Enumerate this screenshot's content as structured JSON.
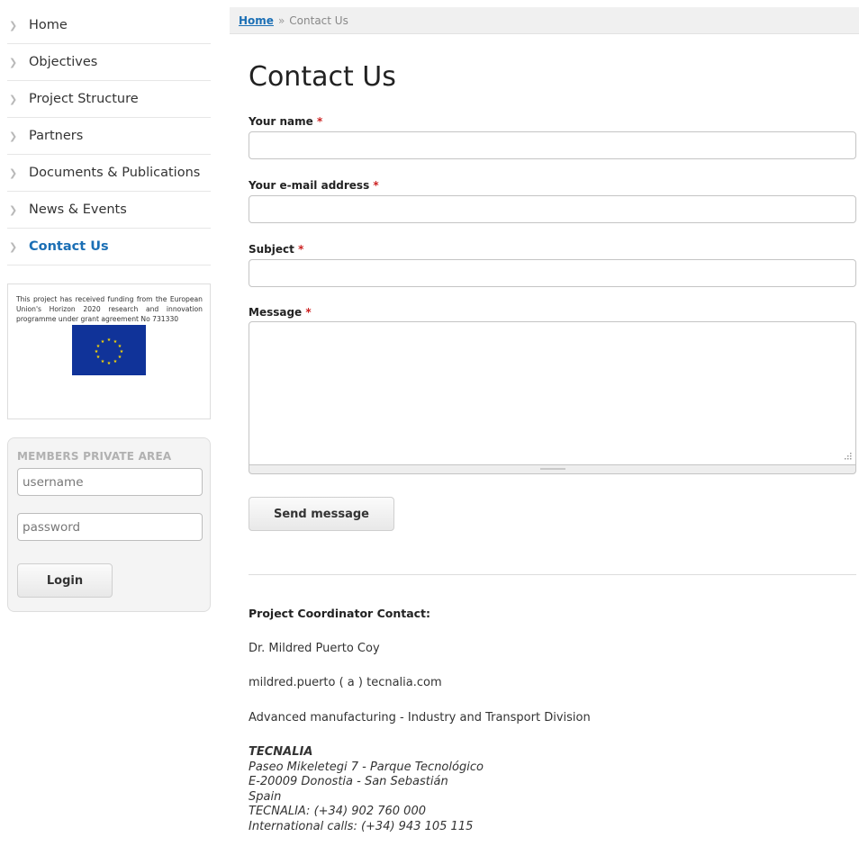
{
  "sidebar": {
    "nav": [
      {
        "label": "Home"
      },
      {
        "label": "Objectives"
      },
      {
        "label": "Project Structure"
      },
      {
        "label": "Partners"
      },
      {
        "label": "Documents & Publications"
      },
      {
        "label": "News & Events"
      },
      {
        "label": "Contact Us",
        "active": true
      }
    ],
    "funding_text": "This project has received funding from the European Union's Horizon 2020 research and innovation programme under grant agreement No 731330",
    "members": {
      "title": "MEMBERS PRIVATE AREA",
      "username_placeholder": "username",
      "password_placeholder": "password",
      "login_label": "Login"
    }
  },
  "breadcrumb": {
    "home": "Home",
    "separator": "»",
    "current": "Contact Us"
  },
  "form": {
    "title": "Contact Us",
    "name_label": "Your name",
    "email_label": "Your e-mail address",
    "subject_label": "Subject",
    "message_label": "Message",
    "required_mark": "*",
    "send_label": "Send message"
  },
  "contact": {
    "heading": "Project Coordinator Contact:",
    "person": "Dr. Mildred Puerto Coy",
    "email": "mildred.puerto ( a ) tecnalia.com",
    "division": "Advanced manufacturing  - Industry and Transport Division",
    "org": "TECNALIA",
    "address_line1": "Paseo Mikeletegi 7 - Parque Tecnológico",
    "address_line2": "E-20009 Donostia - San Sebastián",
    "country": "Spain",
    "phone": "TECNALIA: (+34) 902 760 000",
    "intl_phone": "International calls: (+34) 943 105 115"
  },
  "colors": {
    "accent": "#1b6fb5",
    "required": "#cc2222",
    "eu_blue": "#103399",
    "eu_stars": "#ffdd00"
  }
}
